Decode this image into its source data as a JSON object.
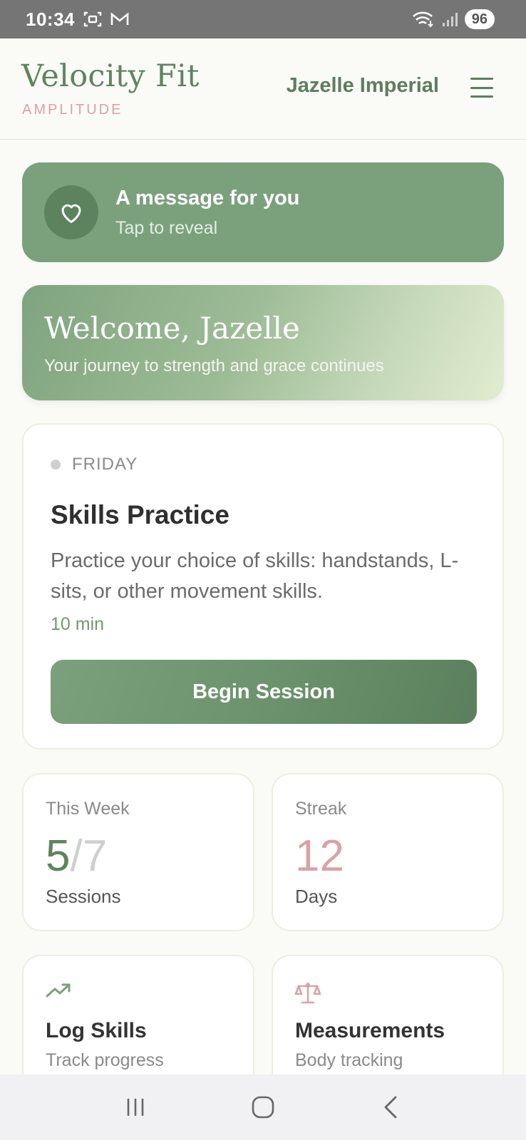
{
  "status_bar": {
    "time": "10:34",
    "battery": "96"
  },
  "header": {
    "app_name": "Velocity Fit",
    "app_subtitle": "AMPLITUDE",
    "user_name": "Jazelle Imperial"
  },
  "message": {
    "title": "A message for you",
    "subtitle": "Tap to reveal"
  },
  "welcome": {
    "title": "Welcome, Jazelle",
    "subtitle": "Your journey to strength and grace continues"
  },
  "session": {
    "day": "FRIDAY",
    "title": "Skills Practice",
    "description": "Practice your choice of skills: handstands, L-sits, or other movement skills.",
    "duration": "10 min",
    "button_label": "Begin Session"
  },
  "stats": {
    "week": {
      "label": "This Week",
      "completed": "5",
      "separator": "/",
      "total": "7",
      "unit": "Sessions"
    },
    "streak": {
      "label": "Streak",
      "value": "12",
      "unit": "Days"
    }
  },
  "actions": {
    "log_skills": {
      "title": "Log Skills",
      "subtitle": "Track progress",
      "icon": "trending-up-icon"
    },
    "measurements": {
      "title": "Measurements",
      "subtitle": "Body tracking",
      "icon": "scale-icon"
    }
  },
  "colors": {
    "primary_green": "#5e8460",
    "banner_green": "#7aa17c",
    "accent_pink": "#d9a2a6",
    "background": "#fafaf7"
  }
}
